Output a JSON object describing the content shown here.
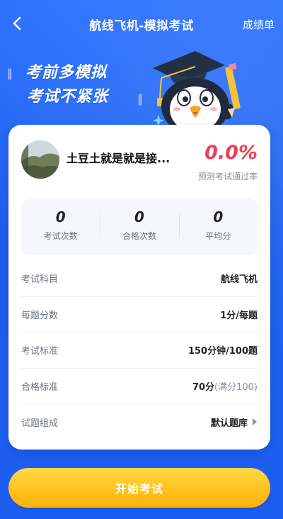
{
  "header": {
    "title": "航线飞机-模拟考试",
    "right_link": "成绩单"
  },
  "slogan": {
    "line1": "考前多模拟",
    "line2": "考试不紧张"
  },
  "profile": {
    "name": "土豆土就是就是接...",
    "pass_rate": "0.0%",
    "pass_rate_label": "预测考试通过率"
  },
  "stats": [
    {
      "value": "0",
      "label": "考试次数"
    },
    {
      "value": "0",
      "label": "合格次数"
    },
    {
      "value": "0",
      "label": "平均分"
    }
  ],
  "details": {
    "subject": {
      "label": "考试科目",
      "value": "航线飞机"
    },
    "per_question": {
      "label": "每题分数",
      "value": "1分/每题"
    },
    "standard": {
      "label": "考试标准",
      "value": "150分钟/100题"
    },
    "pass_standard": {
      "label": "合格标准",
      "value": "70分",
      "note": "(满分100)"
    },
    "composition": {
      "label": "试题组成",
      "value": "默认题库"
    }
  },
  "start_button": "开始考试",
  "colors": {
    "background": "#1f63f2",
    "accent_red": "#ee4056",
    "button_yellow": "#ffc21b"
  },
  "icons": {
    "back": "chevron-left-icon",
    "row_arrow": "chevron-right-icon",
    "mascot": "penguin-graduate-mascot"
  }
}
